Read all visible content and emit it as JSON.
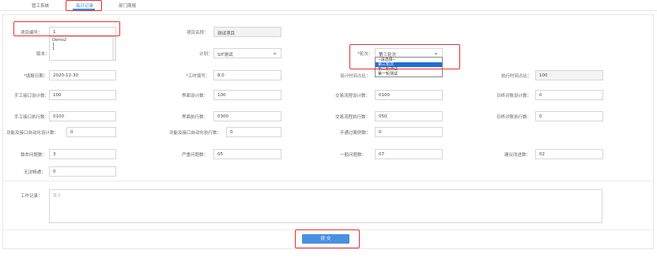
{
  "tabs": [
    {
      "label": "管工系统"
    },
    {
      "label": "每日记录"
    },
    {
      "label": "部门周报"
    }
  ],
  "form": {
    "project_code": {
      "label": "项目编号：",
      "value": "1"
    },
    "project_name": {
      "label": "项目名称：",
      "value": "测试项目"
    },
    "version": {
      "label": "版本：",
      "options": [
        "Demo2",
        "1",
        "1"
      ]
    },
    "plan": {
      "label": "计划：",
      "value": "SIT测试"
    },
    "round": {
      "label": "*轮次：",
      "value": "第三轮次",
      "options": [
        "--请选择--",
        "第三轮次",
        "第二轮测试",
        "第一轮测试"
      ],
      "selected_index": 1
    },
    "fill_date": {
      "label": "*填报日期：",
      "value": "2020-12-30"
    },
    "hours": {
      "label": "*工时填写：",
      "value": "8.0"
    },
    "design_ratio": {
      "label": "设计时间占比：",
      "value": ""
    },
    "exec_ratio": {
      "label": "执行时间占比：",
      "value": "100"
    },
    "manual_if_design": {
      "label": "手工接口设计数：",
      "value": "100"
    },
    "ui_design": {
      "label": "界面设计数：",
      "value": "100"
    },
    "txn_flow_design": {
      "label": "交易流程设计数：",
      "value": "0100"
    },
    "daily_reconcile_design": {
      "label": "日终对账设计数：",
      "value": "0"
    },
    "manual_if_exec": {
      "label": "手工接口执行数：",
      "value": "0100"
    },
    "ui_exec": {
      "label": "界面执行数：",
      "value": "0300"
    },
    "txn_flow_exec": {
      "label": "交易流程执行数：",
      "value": "050"
    },
    "daily_reconcile_exec": {
      "label": "日终对账执行数：",
      "value": "0"
    },
    "auto_design": {
      "label": "功能及接口自动化设计数：",
      "value": "0"
    },
    "auto_exec": {
      "label": "功能及接口自动化执行数：",
      "value": "0"
    },
    "fail_cases": {
      "label": "不通过案例数：",
      "value": "0"
    },
    "fatal_issues": {
      "label": "致命问题数：",
      "value": "3"
    },
    "severe_issues": {
      "label": "严重问题数：",
      "value": "05"
    },
    "normal_issues": {
      "label": "一般问题数：",
      "value": "07"
    },
    "suggestions": {
      "label": "建议改进数：",
      "value": "02"
    },
    "blocked": {
      "label": "无法畅通：",
      "value": "0"
    },
    "work_log": {
      "label": "工作记录：",
      "placeholder": "备注"
    },
    "submit_label": "提 交"
  },
  "colors": {
    "accent": "#3b8fe6",
    "highlight": "#e8302a",
    "primary_button": "#4a90e2"
  }
}
